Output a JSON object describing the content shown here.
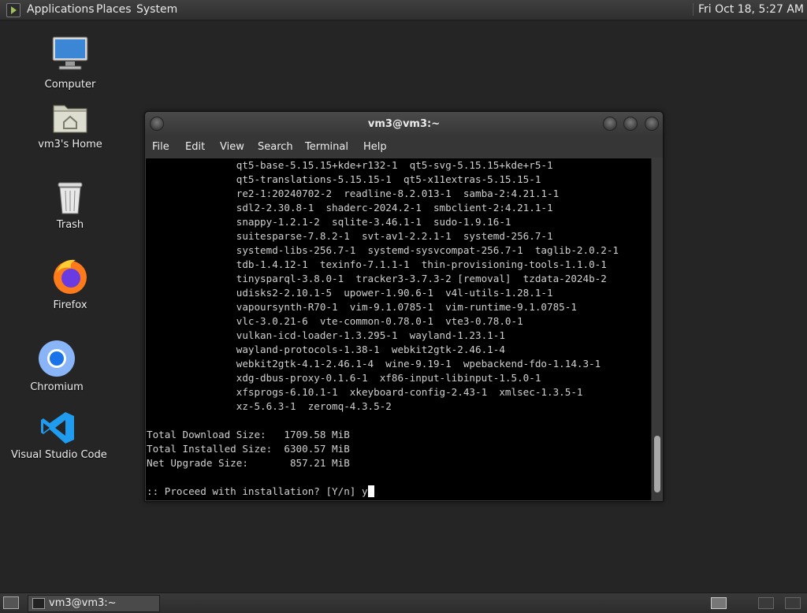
{
  "top_panel": {
    "applications": "Applications",
    "places": "Places",
    "system": "System",
    "clock": "Fri Oct 18,  5:27 AM"
  },
  "desktop": {
    "computer": "Computer",
    "home": "vm3's Home",
    "trash": "Trash",
    "firefox": "Firefox",
    "chromium": "Chromium",
    "vscode": "Visual Studio Code"
  },
  "terminal": {
    "title": "vm3@vm3:~",
    "menu": {
      "file": "File",
      "edit": "Edit",
      "view": "View",
      "search": "Search",
      "terminal": "Terminal",
      "help": "Help"
    },
    "lines": [
      "               qt5-base-5.15.15+kde+r132-1  qt5-svg-5.15.15+kde+r5-1",
      "               qt5-translations-5.15.15-1  qt5-x11extras-5.15.15-1",
      "               re2-1:20240702-2  readline-8.2.013-1  samba-2:4.21.1-1",
      "               sdl2-2.30.8-1  shaderc-2024.2-1  smbclient-2:4.21.1-1",
      "               snappy-1.2.1-2  sqlite-3.46.1-1  sudo-1.9.16-1",
      "               suitesparse-7.8.2-1  svt-av1-2.2.1-1  systemd-256.7-1",
      "               systemd-libs-256.7-1  systemd-sysvcompat-256.7-1  taglib-2.0.2-1",
      "               tdb-1.4.12-1  texinfo-7.1.1-1  thin-provisioning-tools-1.1.0-1",
      "               tinysparql-3.8.0-1  tracker3-3.7.3-2 [removal]  tzdata-2024b-2",
      "               udisks2-2.10.1-5  upower-1.90.6-1  v4l-utils-1.28.1-1",
      "               vapoursynth-R70-1  vim-9.1.0785-1  vim-runtime-9.1.0785-1",
      "               vlc-3.0.21-6  vte-common-0.78.0-1  vte3-0.78.0-1",
      "               vulkan-icd-loader-1.3.295-1  wayland-1.23.1-1",
      "               wayland-protocols-1.38-1  webkit2gtk-2.46.1-4",
      "               webkit2gtk-4.1-2.46.1-4  wine-9.19-1  wpebackend-fdo-1.14.3-1",
      "               xdg-dbus-proxy-0.1.6-1  xf86-input-libinput-1.5.0-1",
      "               xfsprogs-6.10.1-1  xkeyboard-config-2.43-1  xmlsec-1.3.5-1",
      "               xz-5.6.3-1  zeromq-4.3.5-2",
      "",
      "Total Download Size:   1709.58 MiB",
      "Total Installed Size:  6300.57 MiB",
      "Net Upgrade Size:       857.21 MiB",
      ""
    ],
    "prompt": ":: Proceed with installation? [Y/n] y"
  },
  "taskbar": {
    "task_label": "vm3@vm3:~"
  }
}
